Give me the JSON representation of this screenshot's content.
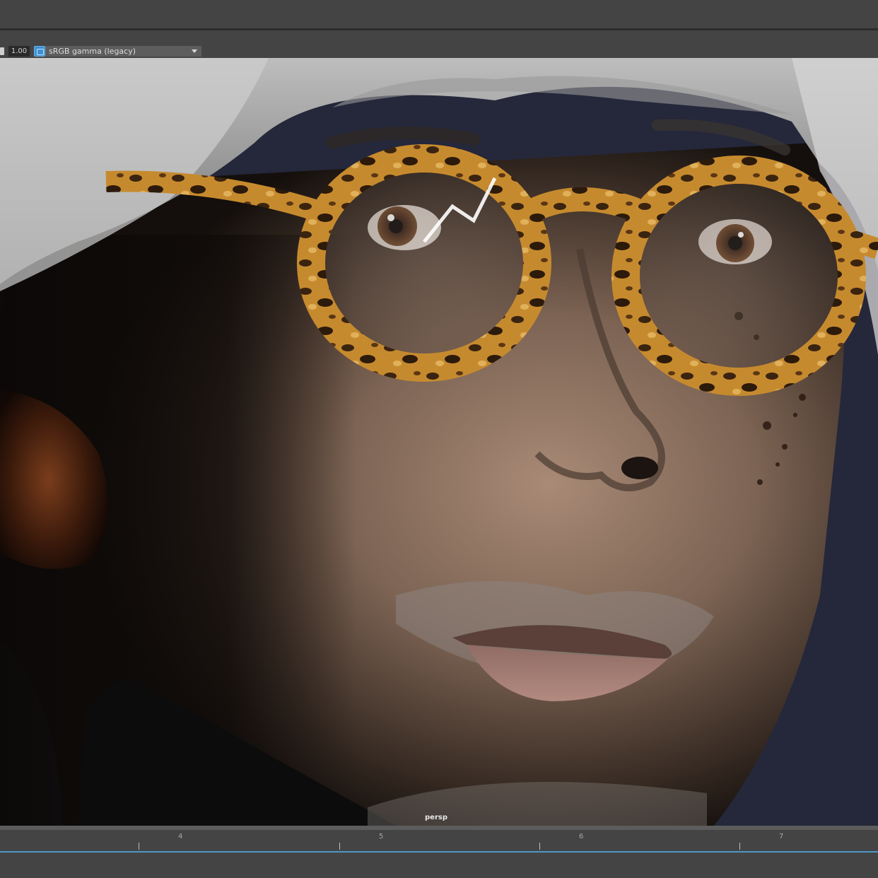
{
  "toolbar": {
    "exposure_value": "1.00",
    "color_space": "sRGB gamma (legacy)",
    "colorspace_toggle_icon": "color-management-icon",
    "dropdown_icon": "chevron-down-icon"
  },
  "viewport": {
    "camera": "persp",
    "background_color": "#25273a"
  },
  "timeline": {
    "frames": [
      "4",
      "5",
      "6",
      "7"
    ],
    "accent_color": "#4f97c4"
  }
}
